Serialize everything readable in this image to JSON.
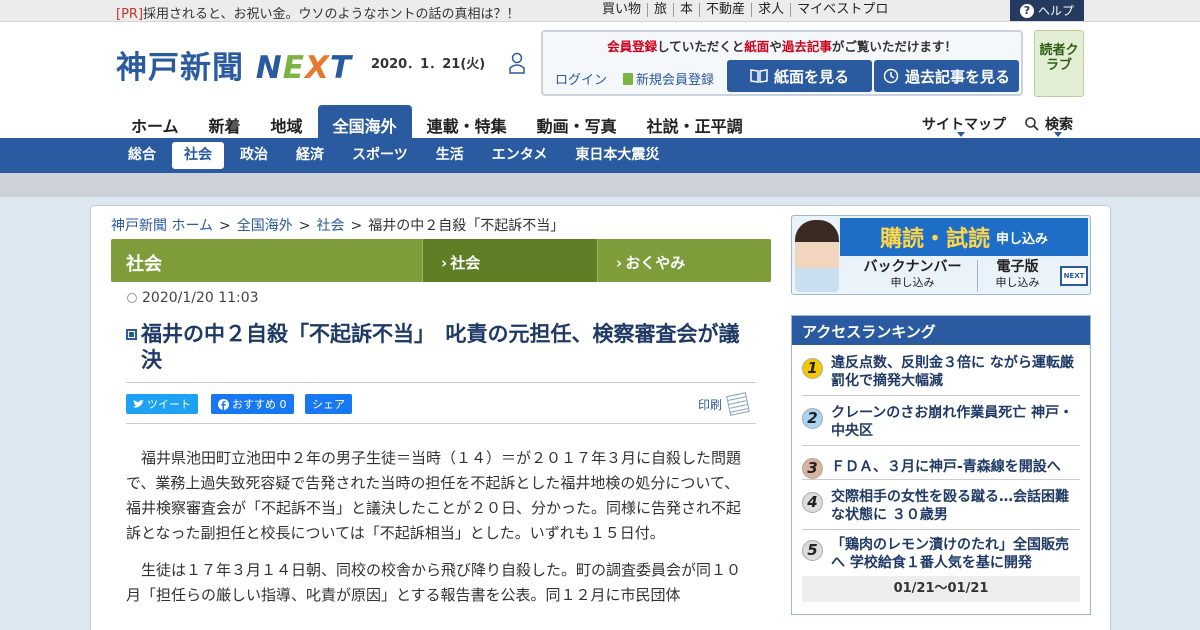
{
  "topbar": {
    "pr_tag": "[PR]",
    "pr_text": "採用されると、お祝い金。ウソのようなホントの話の真相は？！",
    "links": [
      "買い物",
      "旅",
      "本",
      "不動産",
      "求人",
      "マイベストプロ"
    ],
    "help": "ヘルプ"
  },
  "header": {
    "logo_text": "神戸新聞",
    "logo_n": "N",
    "logo_e": "E",
    "logo_x": "X",
    "logo_t": "T",
    "date": "2020．1．21(火)",
    "member_msg_1": "会員登録",
    "member_msg_2": "していただくと",
    "member_msg_3": "紙面",
    "member_msg_4": "や",
    "member_msg_5": "過去記事",
    "member_msg_6": "がご覧いただけます！",
    "login": "ログイン",
    "register": "新規会員登録",
    "btn_paper": "紙面を見る",
    "btn_past": "過去記事を見る",
    "reader_club": "読者クラブ"
  },
  "gnav": {
    "items": [
      "ホーム",
      "新着",
      "地域",
      "全国海外",
      "連載・特集",
      "動画・写真",
      "社説・正平調"
    ],
    "sitemap": "サイトマップ",
    "search": "検索"
  },
  "subnav": {
    "items": [
      "総合",
      "社会",
      "政治",
      "経済",
      "スポーツ",
      "生活",
      "エンタメ",
      "東日本大震災"
    ]
  },
  "breadcrumb": {
    "home": "神戸新聞 ホーム",
    "c1": "全国海外",
    "c2": "社会",
    "current": "福井の中２自殺「不起訴不当」",
    "sep": ">"
  },
  "category": {
    "title": "社会",
    "tab1": "社会",
    "tab2": "おくやみ"
  },
  "article": {
    "timestamp": "2020/1/20 11:03",
    "headline": "福井の中２自殺「不起訴不当」　叱責の元担任、検察審査会が議決",
    "tweet": "ツイート",
    "fb_recommend": "おすすめ 0",
    "fb_share": "シェア",
    "print": "印刷",
    "p1": "福井県池田町立池田中２年の男子生徒＝当時（１４）＝が２０１７年３月に自殺した問題で、業務上過失致死容疑で告発された当時の担任を不起訴とした福井地検の処分について、福井検察審査会が「不起訴不当」と議決したことが２０日、分かった。同様に告発され不起訴となった副担任と校長については「不起訴相当」とした。いずれも１５日付。",
    "p2": "生徒は１７年３月１４日朝、同校の校舎から飛び降り自殺した。町の調査委員会が同１０月「担任らの厳しい指導、叱責が原因」とする報告書を公表。同１２月に市民団体"
  },
  "ad": {
    "big": "購読・試読",
    "small": "申し込み",
    "backnumber": "バックナンバー",
    "backnumber_sub": "申し込み",
    "digital": "電子版",
    "digital_sub": "申し込み",
    "tv_label": "NEXT"
  },
  "ranking": {
    "title": "アクセスランキング",
    "items": [
      {
        "num": "1",
        "text": "違反点数、反則金３倍に ながら運転厳罰化で摘発大幅減"
      },
      {
        "num": "2",
        "text": "クレーンのさお崩れ作業員死亡 神戸・中央区"
      },
      {
        "num": "3",
        "text": "ＦＤＡ、３月に神戸-青森線を開設へ"
      },
      {
        "num": "4",
        "text": "交際相手の女性を殴る蹴る…会話困難な状態に ３０歳男"
      },
      {
        "num": "5",
        "text": "「鶏肉のレモン漬けのたれ」全国販売へ 学校給食１番人気を基に開発"
      }
    ],
    "range": "01/21～01/21"
  },
  "colors": {
    "brand_blue": "#2a5aa0",
    "category_green": "#7d9c3a",
    "alert_red": "#d0021b"
  }
}
